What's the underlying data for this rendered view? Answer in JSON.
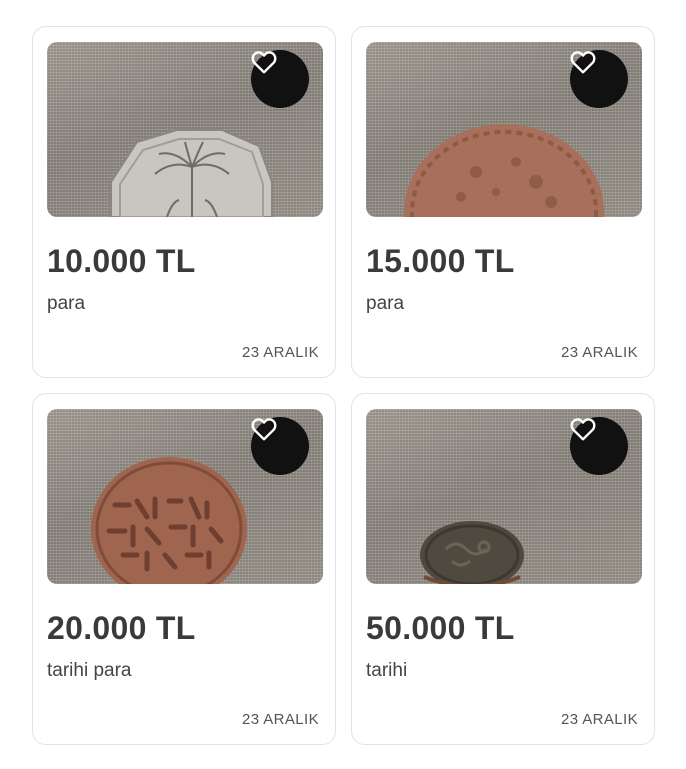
{
  "listings": [
    {
      "price": "10.000 TL",
      "title": "para",
      "date": "23 ARALIK",
      "coin": "silver-octagon-palm"
    },
    {
      "price": "15.000 TL",
      "title": "para",
      "date": "23 ARALIK",
      "coin": "copper-round"
    },
    {
      "price": "20.000 TL",
      "title": "tarihi para",
      "date": "23 ARALIK",
      "coin": "copper-inscribed"
    },
    {
      "price": "50.000 TL",
      "title": "tarihi",
      "date": "23 ARALIK",
      "coin": "dark-bronze"
    }
  ],
  "icons": {
    "favorite": "heart-outline-icon"
  },
  "colors": {
    "fav_bg": "#111111",
    "price": "#3a3a3a",
    "border": "#e3e3e3"
  }
}
